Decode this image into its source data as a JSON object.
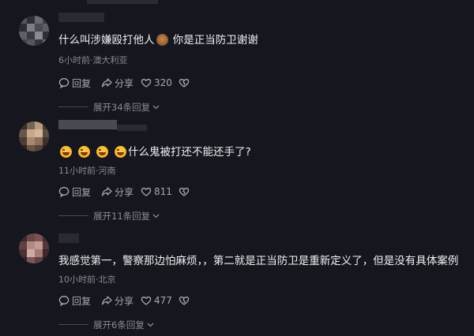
{
  "comments": [
    {
      "text_before": "什么叫涉嫌殴打他人",
      "text_after": " 你是正当防卫谢谢",
      "meta": "6小时前·澳大利亚",
      "reply_label": "回复",
      "share_label": "分享",
      "likes": "320",
      "expand_label": "展开34条回复"
    },
    {
      "text_after": "什么鬼被打还不能还手了?",
      "meta": "11小时前·河南",
      "reply_label": "回复",
      "share_label": "分享",
      "likes": "811",
      "expand_label": "展开11条回复"
    },
    {
      "text": "我感觉第一，警察那边怕麻烦，，第二就是正当防卫是重新定义了，但是没有具体案例",
      "meta": "10小时前·北京",
      "reply_label": "回复",
      "share_label": "分享",
      "likes": "477",
      "expand_label": "展开6条回复"
    }
  ],
  "icons": {
    "reply": "reply-icon",
    "share": "share-icon",
    "like": "heart-icon",
    "dislike": "broken-heart-icon",
    "expand": "chevron-down-icon"
  }
}
